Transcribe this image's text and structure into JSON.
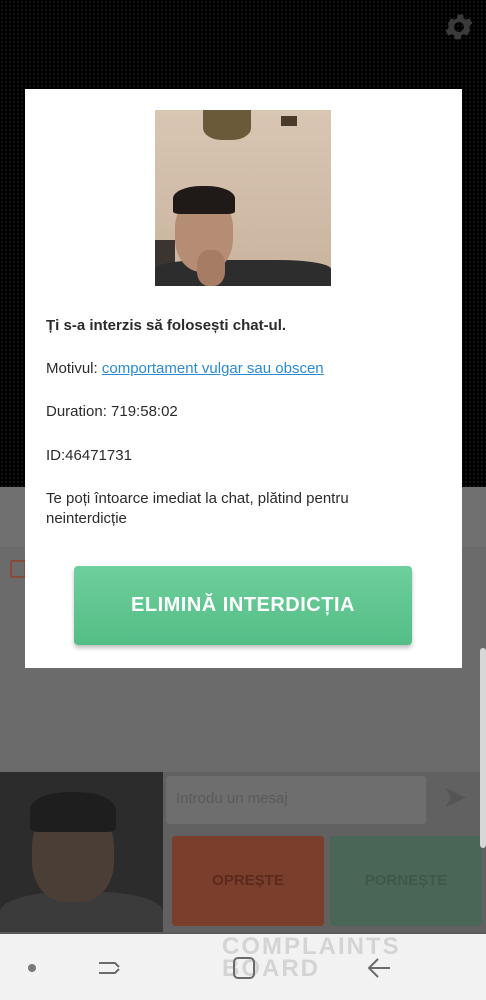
{
  "background": {
    "message_placeholder": "Introdu un mesaj",
    "stop_label": "OPREȘTE",
    "start_label": "PORNEȘTE"
  },
  "modal": {
    "title": "Ți s-a interzis să folosești chat-ul.",
    "reason_label": "Motivul: ",
    "reason_link": "comportament vulgar sau obscen",
    "duration": "Duration: 719:58:02",
    "id": "ID:46471731",
    "info": "Te poți întoarce imediat la chat, plătind pentru neinterdicție",
    "button_label": "ELIMINĂ INTERDICȚIA"
  },
  "watermark": {
    "line1": "COMPLAINTS",
    "line2": "BOARD"
  },
  "colors": {
    "accent_green": "#5cc48e",
    "link_blue": "#2b8ad6",
    "stop_red": "#7a3e2c"
  },
  "icons": [
    "gear-icon",
    "send-icon",
    "nav-recent-icon",
    "nav-home-icon",
    "nav-back-icon"
  ]
}
